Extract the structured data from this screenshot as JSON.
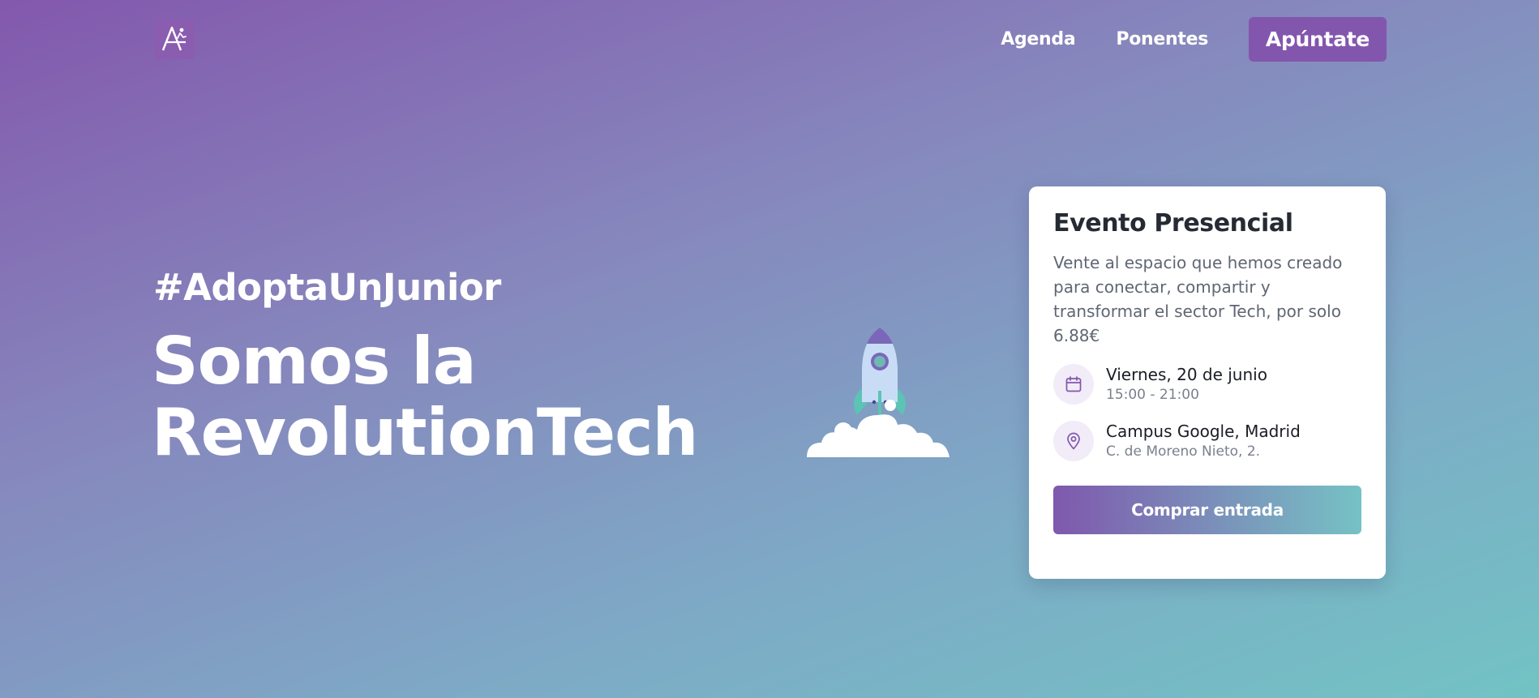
{
  "header": {
    "logo_icon": "adopta-logo-icon",
    "nav": [
      {
        "label": "Agenda"
      },
      {
        "label": "Ponentes"
      }
    ],
    "cta_label": "Apúntate"
  },
  "hero": {
    "hashtag": "#AdoptaUnJunior",
    "title_line1": "Somos la",
    "title_line2": "RevolutionTech",
    "illustration": "rocket-launch-icon"
  },
  "event_card": {
    "title": "Evento Presencial",
    "description": "Vente al espacio que hemos creado para conectar, compartir y transformar el sector Tech, por solo 6.88€",
    "date": {
      "icon": "calendar-icon",
      "main": "Viernes, 20 de junio",
      "sub": "15:00 - 21:00"
    },
    "location": {
      "icon": "location-pin-icon",
      "main": "Campus Google, Madrid",
      "sub": "C. de Moreno Nieto, 2."
    },
    "button_label": "Comprar entrada"
  },
  "colors": {
    "brand_purple": "#8356ae",
    "brand_teal": "#76c2c5",
    "icon_bg": "#f1ecf7"
  }
}
